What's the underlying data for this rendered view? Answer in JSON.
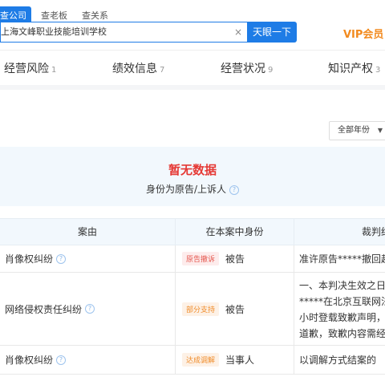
{
  "search": {
    "tabs": [
      "查公司",
      "查老板",
      "查关系"
    ],
    "query": "上海文峰职业技能培训学校",
    "clear_glyph": "×",
    "button_label": "天眼一下"
  },
  "vip_label": "VIP会员",
  "categories": [
    {
      "label": "经营风险",
      "count": "1"
    },
    {
      "label": "绩效信息",
      "count": "7"
    },
    {
      "label": "经营状况",
      "count": "9"
    },
    {
      "label": "知识产权",
      "count": "3"
    }
  ],
  "filter": {
    "label": "全部年份"
  },
  "empty": {
    "title": "暂无数据",
    "subtitle": "身份为原告/上诉人"
  },
  "table": {
    "headers": [
      "案由",
      "在本案中身份",
      "裁判结果"
    ],
    "rows": [
      {
        "cause": "肖像权纠纷",
        "tag": "原告撤诉",
        "role": "被告",
        "judgment": [
          "准许原告*****撤回起诉"
        ]
      },
      {
        "cause": "网络侵权责任纠纷",
        "tag": "部分支持",
        "role": "被告",
        "judgment": [
          "一、本判决生效之日起",
          "*****在北京互联网法院",
          "小时登载致歉声明，",
          "道歉，致歉内容需经"
        ]
      },
      {
        "cause": "肖像权纠纷",
        "tag": "达成调解",
        "role": "当事人",
        "judgment": [
          "以调解方式结案的"
        ]
      }
    ]
  },
  "colors": {
    "accent": "#1e7ce6",
    "vip": "#f28a1e",
    "empty_title": "#e53935",
    "panel_bg": "#f2f8fd"
  }
}
